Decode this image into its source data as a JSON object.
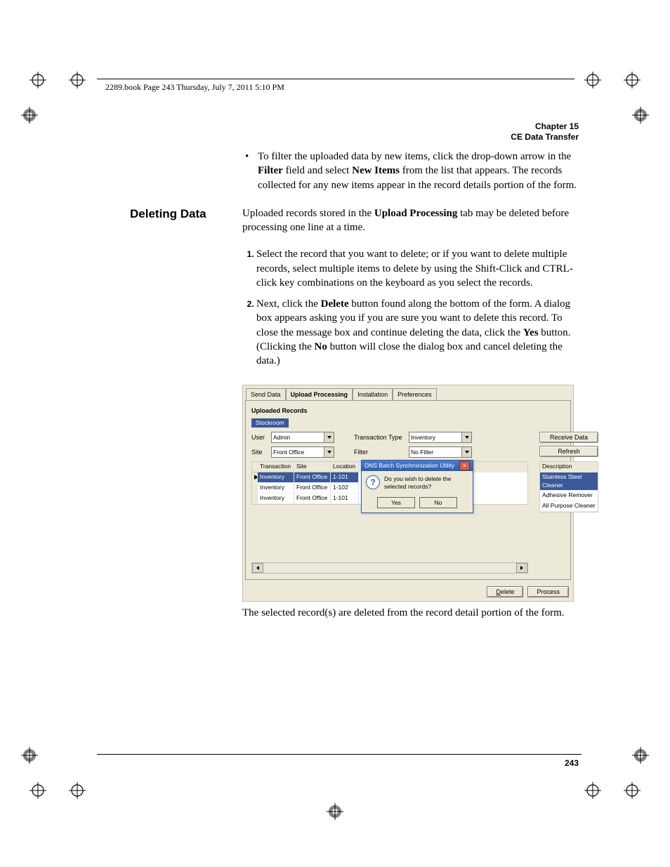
{
  "header": {
    "book_line": "2289.book  Page 243  Thursday, July 7, 2011  5:10 PM"
  },
  "chapter": {
    "num": "Chapter 15",
    "title": "CE Data Transfer"
  },
  "bullet_pre": "To filter the uploaded data by new items, click the drop-down arrow in the ",
  "bullet_field": "Filter",
  "bullet_mid": " field and select ",
  "bullet_newitems": "New Items",
  "bullet_post": " from the list that appears. The records collected for any new items appear in the record details portion of the form.",
  "section": {
    "title": "Deleting Data",
    "intro_pre": "Uploaded records stored in the ",
    "intro_tab": "Upload Processing",
    "intro_post": " tab may be deleted before processing one line at a time."
  },
  "step1": "Select the record that you want to delete; or if you want to delete multiple records, select multiple items to delete by using the Shift-Click and CTRL-click key combinations on the keyboard as you select the records.",
  "step2_pre": "Next, click the ",
  "step2_delete": "Delete",
  "step2_mid": " button found along the bottom of the form. A dialog box appears asking you if you are sure you want to delete this record. To close the message box and continue deleting the data, click the ",
  "step2_yes": "Yes",
  "step2_mid2": " button. (Clicking the ",
  "step2_no": "No",
  "step2_post": " button will close the dialog box and cancel deleting the data.)",
  "caption": "The selected record(s) are deleted from the record detail portion of the form.",
  "page_number": "243",
  "ui": {
    "tabs": [
      "Send Data",
      "Upload Processing",
      "Installation",
      "Preferences"
    ],
    "group": "Uploaded Records",
    "subtab": "Stockroom",
    "labels": {
      "user": "User",
      "site": "Site",
      "ttype": "Transaction Type",
      "filter": "Filter"
    },
    "values": {
      "user": "Admin",
      "site": "Front Office",
      "ttype": "Inventory",
      "filter": "No Filter"
    },
    "buttons": {
      "receive": "Receive Data",
      "refresh": "Refresh",
      "delete": "Delete",
      "process": "Process"
    },
    "grid": {
      "headers": [
        "Transaction",
        "Site",
        "Location"
      ],
      "rows": [
        {
          "t": "Inventory",
          "s": "Front Office",
          "l": "1-101",
          "selected": true
        },
        {
          "t": "Inventory",
          "s": "Front Office",
          "l": "1-102"
        },
        {
          "t": "Inventory",
          "s": "Front Office",
          "l": "1-101"
        }
      ],
      "desc_header": "Description",
      "desc": [
        "Stainless Steel Cleaner",
        "Adhesive Remover",
        "All Purpose Cleaner"
      ]
    },
    "dialog": {
      "title": "DNS Batch Synchronization Utility",
      "msg": "Do you wish to delete the selected records?",
      "yes": "Yes",
      "no": "No"
    }
  }
}
